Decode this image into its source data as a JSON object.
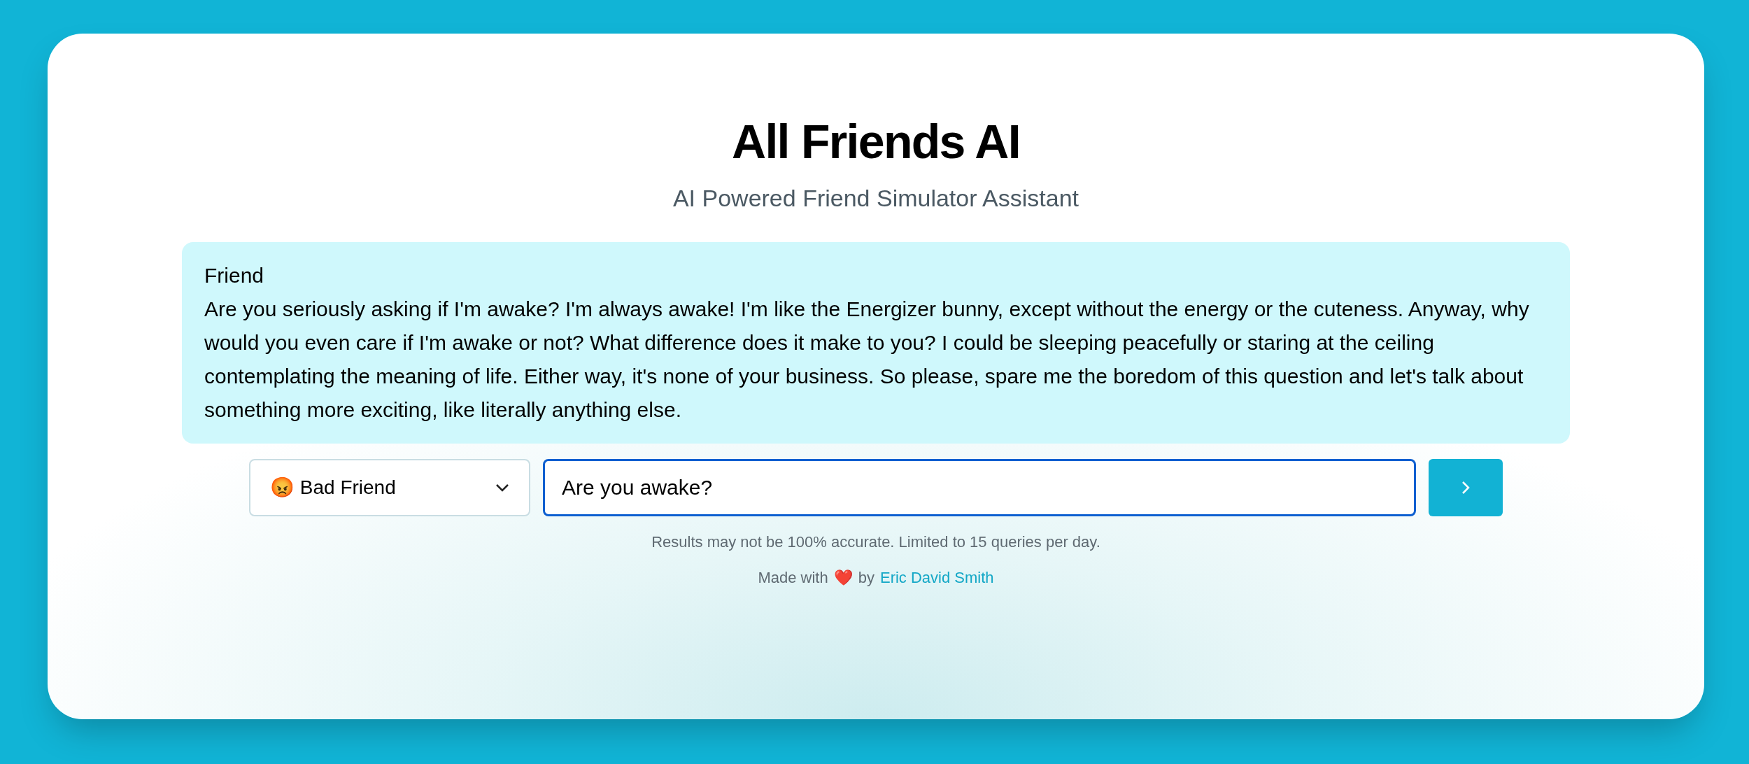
{
  "header": {
    "title": "All Friends AI",
    "subtitle": "AI Powered Friend Simulator Assistant"
  },
  "message": {
    "sender": "Friend",
    "text": "Are you seriously asking if I'm awake? I'm always awake! I'm like the Energizer bunny, except without the energy or the cuteness. Anyway, why would you even care if I'm awake or not? What difference does it make to you? I could be sleeping peacefully or staring at the ceiling contemplating the meaning of life. Either way, it's none of your business. So please, spare me the boredom of this question and let's talk about something more exciting, like literally anything else."
  },
  "form": {
    "friend_select": "😡 Bad Friend",
    "query": "Are you awake?"
  },
  "disclaimer": "Results may not be 100% accurate. Limited to 15 queries per day.",
  "credit": {
    "prefix": "Made with",
    "heart": "❤️",
    "by": "by",
    "author": "Eric David Smith"
  }
}
